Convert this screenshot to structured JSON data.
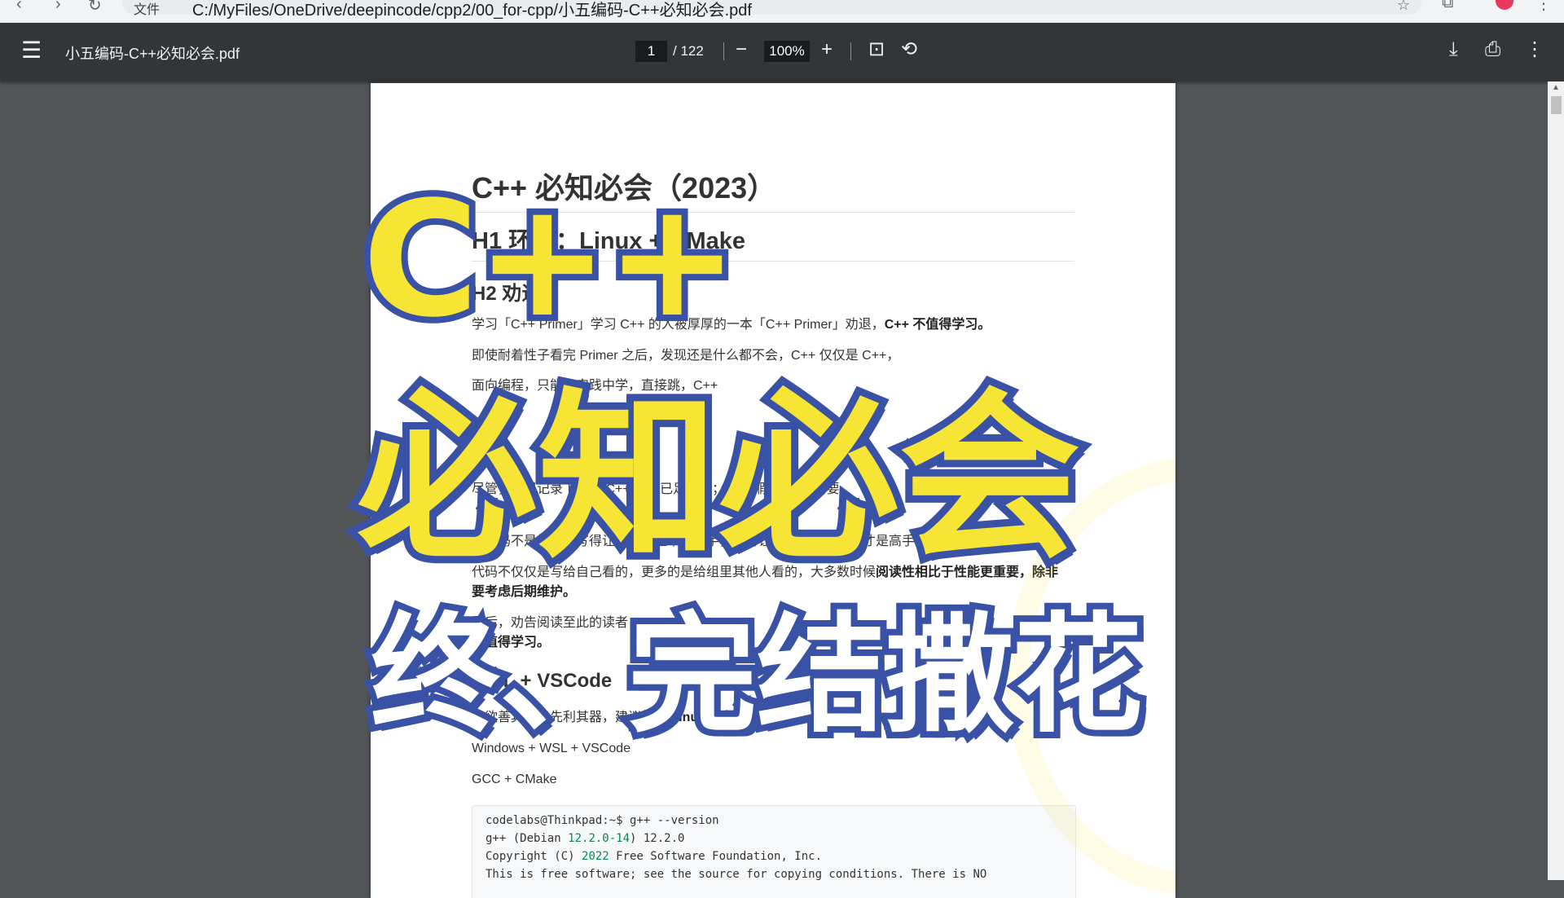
{
  "browser": {
    "nav_back": "‹",
    "nav_forward": "›",
    "reload": "↻",
    "info_label": "文件",
    "url": "C:/MyFiles/OneDrive/deepincode/cpp2/00_for-cpp/小五编码-C++必知必会.pdf",
    "star_icon": "☆",
    "ext_icon": "⧉",
    "kebab": "⋮"
  },
  "toolbar": {
    "menu_icon": "☰",
    "document_title": "小五编码-C++必知必会.pdf",
    "current_page": "1",
    "page_total": "/ 122",
    "zoom_out": "−",
    "zoom_level": "100%",
    "zoom_in": "+",
    "fit_icon": "⊡",
    "rotate_icon": "⟲",
    "download_icon": "⤓",
    "print_icon": "⎙",
    "more_icon": "⋮"
  },
  "pdf": {
    "title": "C++ 必知必会（2023）",
    "h1": "H1 环境：Linux + CMake",
    "section1_heading": "H2 劝退",
    "paragraphs": [
      "学习「C++ Primer」学习 C++ 的人被厚厚的一本「C++ Primer」劝退，",
      "即使耐着性子看完 Primer 之后，发现还是什么都不会，C++ 仅仅是 C++，",
      "面向编程，只能从实践中学，直接跳，C++",
      "尽管，这里记录下来的 C++ 代码已足够了；打 ... 假如你 ... 需要",
      "写代码不是炫技，写得让人看不懂不是高手，写得让小白都能看明白才是高手。",
      "代码不仅仅是写给自己看的，更多的是给组里其他人看的，大多数时候",
      "要考虑后期维护。",
      "最后，劝告阅读至此的读者，",
      "不值得学习。"
    ],
    "bold_spans": {
      "not_worth": "C++ 不值得学习。",
      "readability": "阅读性相比于性能更重要，除非",
      "linux_env": "使用 Linux 编程环境开始"
    },
    "section2_heading": "WSL + VSCode",
    "env_intro": "工欲善其事必先利其器，建议",
    "env_line1": "Windows + WSL + VSCode",
    "env_line2": "GCC + CMake",
    "code": {
      "prompt": "codelabs@Thinkpad:~$ g++ --version",
      "line2_pre": "g++ (Debian ",
      "line2_ver": "12.2.0-14",
      "line2_post": ") 12.2.0",
      "line3_pre": "Copyright (C) ",
      "line3_year": "2022",
      "line3_post": " Free Software Foundation, Inc.",
      "line4": "This is free software; see the source for copying conditions.  There is NO"
    }
  },
  "overlay": {
    "cpp": "C++",
    "main": "必知必会",
    "sub": "终、完结撒花"
  },
  "colors": {
    "overlay_yellow": "#f6e534",
    "overlay_blue": "#3a52a6",
    "toolbar_bg": "#323639",
    "viewer_bg": "#525659"
  }
}
